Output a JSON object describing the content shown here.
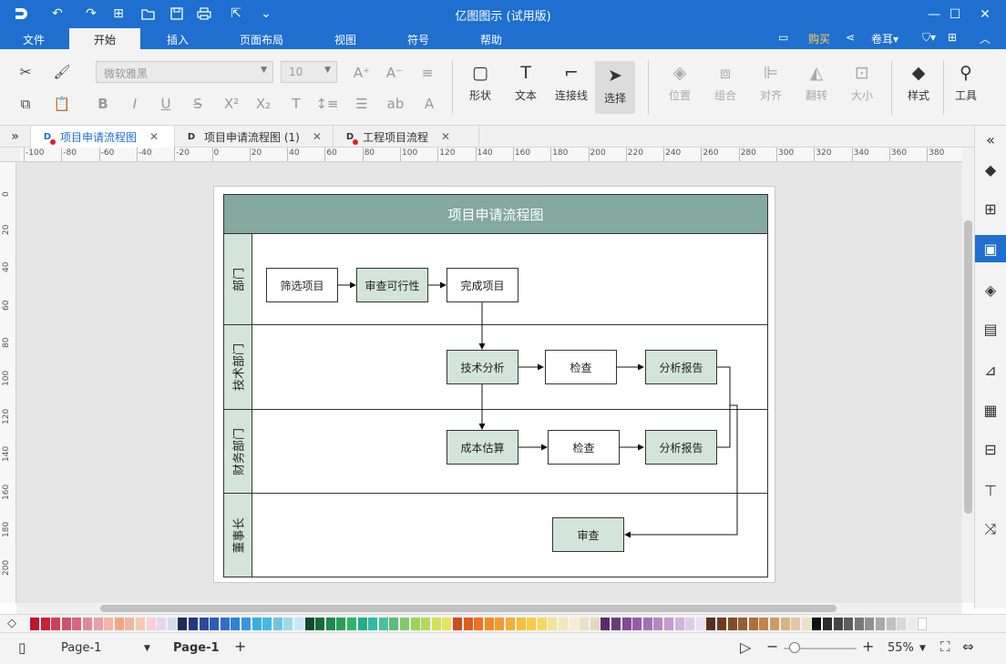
{
  "app": {
    "title": "亿图图示 (试用版)"
  },
  "menu": {
    "items": [
      "文件",
      "开始",
      "插入",
      "页面布局",
      "视图",
      "符号",
      "帮助"
    ],
    "active": "开始",
    "right": {
      "buy": "购买",
      "user": "卷耳"
    }
  },
  "ribbon": {
    "font_name": "微软雅黑",
    "font_size": "10",
    "tools": {
      "shape": "形状",
      "text": "文本",
      "connector": "连接线",
      "select": "选择"
    },
    "arrange": {
      "position": "位置",
      "group": "组合",
      "align": "对齐",
      "flip": "翻转",
      "size": "大小"
    },
    "style": "样式",
    "tools_menu": "工具"
  },
  "tabs": [
    {
      "label": "项目申请流程图"
    },
    {
      "label": "项目申请流程图 (1)"
    },
    {
      "label": "工程项目流程"
    }
  ],
  "ruler": {
    "h_labels": [
      "-100",
      "-80",
      "-60",
      "-40",
      "-20",
      "0",
      "20",
      "40",
      "60",
      "80",
      "100",
      "120",
      "140",
      "160",
      "180",
      "200",
      "220",
      "240",
      "260",
      "280",
      "300",
      "320",
      "340",
      "360",
      "380"
    ],
    "v_labels": [
      "0",
      "20",
      "40",
      "60",
      "80",
      "100",
      "120",
      "140",
      "160",
      "180",
      "200"
    ]
  },
  "diagram": {
    "title": "项目申请流程图",
    "lanes": [
      "部门",
      "技术部门",
      "财务部门",
      "董事长"
    ],
    "nodes": {
      "screen": "筛选项目",
      "review_feasibility": "审查可行性",
      "complete": "完成项目",
      "tech_analysis": "技术分析",
      "tech_check": "检查",
      "tech_report": "分析报告",
      "cost_estimate": "成本估算",
      "fin_check": "检查",
      "fin_report": "分析报告",
      "board_review": "审查"
    }
  },
  "palette": {
    "colors": [
      "#c0152a",
      "#c81f3c",
      "#cf3f5c",
      "#d3506a",
      "#d96680",
      "#de8a98",
      "#e8a0a8",
      "#f0b8a8",
      "#f4a48c",
      "#f5b59f",
      "#f7c9b8",
      "#f5d0d7",
      "#e8d7e6",
      "#d7dbef",
      "#1e2a57",
      "#1f3a7a",
      "#274a9e",
      "#2b5cb8",
      "#2f6fcc",
      "#2f84d6",
      "#3398df",
      "#3aaee0",
      "#47b9de",
      "#6cc6e3",
      "#9fd8ea",
      "#c9e8f3",
      "#0f4a2e",
      "#156b3d",
      "#1c8a4d",
      "#24a15a",
      "#2fb56a",
      "#26a98c",
      "#2eb8a6",
      "#4bbfa2",
      "#58c07a",
      "#7ccc69",
      "#9bd35e",
      "#b5d95a",
      "#d3e05a",
      "#e5e35c",
      "#d24a1e",
      "#e35b1d",
      "#ee7125",
      "#f18a2a",
      "#f49b2e",
      "#f5ad36",
      "#f7bd3d",
      "#f9cc45",
      "#f6d85e",
      "#f2e39a",
      "#f4e7b8",
      "#f5ecd0",
      "#ece0c8",
      "#e6d6c2",
      "#5a2a6c",
      "#6d3a80",
      "#824a94",
      "#955ba8",
      "#a76eb9",
      "#b884c7",
      "#c59ad3",
      "#d3b2de",
      "#e1cbe9",
      "#ecdff1",
      "#5a2c1e",
      "#6e3a22",
      "#844a28",
      "#9a5c30",
      "#ae6e3a",
      "#c08448",
      "#ce9b62",
      "#d9b282",
      "#e3c8a3",
      "#ece0ca",
      "#111111",
      "#2b2b2b",
      "#444444",
      "#5d5d5d",
      "#777777",
      "#909090",
      "#a8a8a8",
      "#c0c0c0",
      "#d8d8d8",
      "#ececec",
      "#ffffff"
    ]
  },
  "status": {
    "page_select": "Page-1",
    "page_tab": "Page-1",
    "zoom": "55%"
  },
  "colors": {
    "accent": "#1e6fd0",
    "pool_header": "#84a99f",
    "lane_fill": "#d2e4dc"
  }
}
